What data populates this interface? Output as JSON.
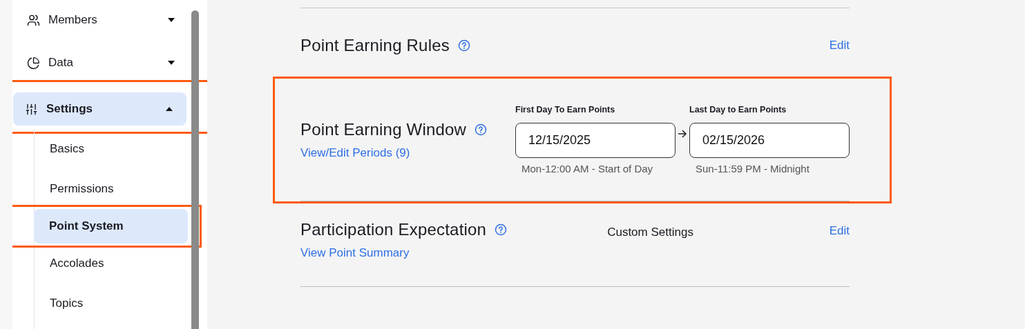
{
  "sidebar": {
    "items": [
      {
        "label": "Members",
        "expanded": false,
        "selected": false,
        "highlighted": false
      },
      {
        "label": "Data",
        "expanded": false,
        "selected": false,
        "highlighted": false
      },
      {
        "label": "Settings",
        "expanded": true,
        "selected": true,
        "highlighted": true,
        "children": [
          {
            "label": "Basics",
            "selected": false,
            "highlighted": false
          },
          {
            "label": "Permissions",
            "selected": false,
            "highlighted": false
          },
          {
            "label": "Point System",
            "selected": true,
            "highlighted": true
          },
          {
            "label": "Accolades",
            "selected": false,
            "highlighted": false
          },
          {
            "label": "Topics",
            "selected": false,
            "highlighted": false
          }
        ]
      }
    ]
  },
  "sections": [
    {
      "kind": "edit",
      "title": "Point Earning Rules",
      "action": "Edit"
    },
    {
      "kind": "window",
      "title": "Point Earning Window",
      "link": "View/Edit Periods (9)",
      "highlighted": true,
      "fields": [
        {
          "label": "First Day To Earn Points",
          "value": "12/15/2025",
          "hint": "Mon-12:00 AM - Start of Day"
        },
        {
          "label": "Last Day to Earn Points",
          "value": "02/15/2026",
          "hint": "Sun-11:59 PM - Midnight"
        }
      ]
    },
    {
      "kind": "summary",
      "title": "Participation Expectation",
      "link": "View Point Summary",
      "value": "Custom Settings",
      "action": "Edit"
    }
  ]
}
